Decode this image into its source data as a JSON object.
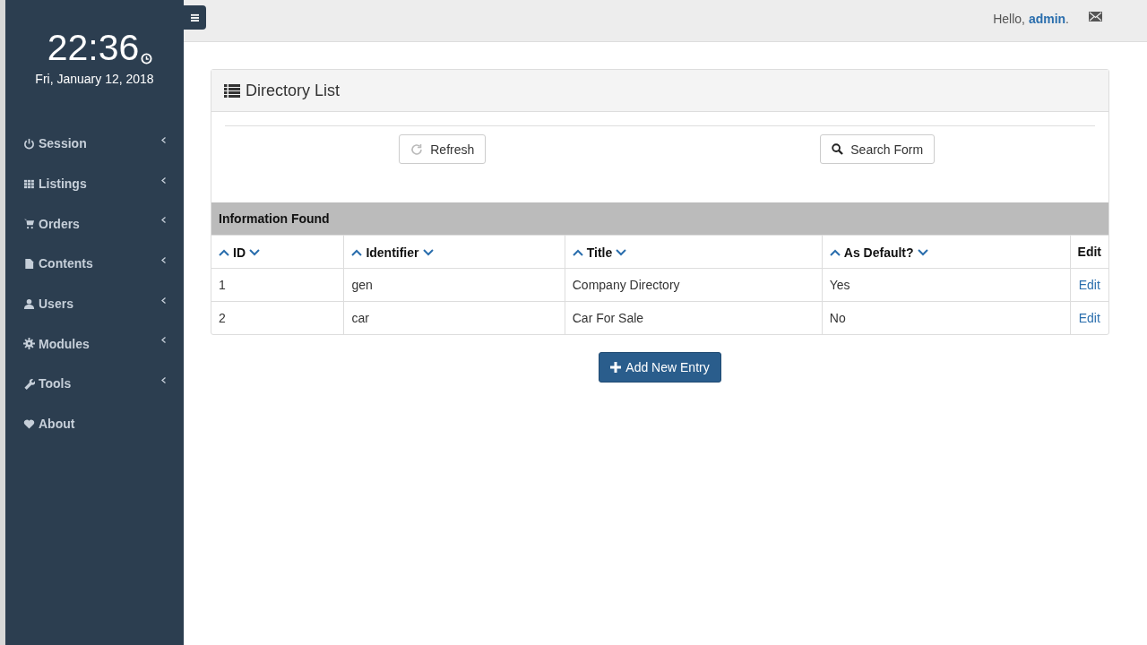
{
  "clock": {
    "time": "22:36",
    "date": "Fri, January 12, 2018"
  },
  "sidebar": {
    "items": [
      {
        "label": "Session",
        "expandable": true
      },
      {
        "label": "Listings",
        "expandable": true
      },
      {
        "label": "Orders",
        "expandable": true
      },
      {
        "label": "Contents",
        "expandable": true
      },
      {
        "label": "Users",
        "expandable": true
      },
      {
        "label": "Modules",
        "expandable": true
      },
      {
        "label": "Tools",
        "expandable": true
      },
      {
        "label": "About",
        "expandable": false
      }
    ]
  },
  "topbar": {
    "greeting": "Hello,",
    "user": "admin",
    "after": "."
  },
  "panel": {
    "title": "Directory List",
    "buttons": [
      "Refresh",
      "Search Form"
    ],
    "section": "Information Found",
    "table": {
      "columns": [
        {
          "label": "ID",
          "sortable": true
        },
        {
          "label": "Identifier",
          "sortable": true
        },
        {
          "label": "Title",
          "sortable": true
        },
        {
          "label": "As Default?",
          "sortable": true
        },
        {
          "label": "Edit",
          "sortable": false
        }
      ],
      "rows": [
        {
          "cells": [
            "1",
            "gen",
            "Company Directory",
            "Yes"
          ],
          "action": "Edit"
        },
        {
          "cells": [
            "2",
            "car",
            "Car For Sale",
            "No"
          ],
          "action": "Edit"
        }
      ]
    }
  },
  "add_button": "Add New Entry"
}
